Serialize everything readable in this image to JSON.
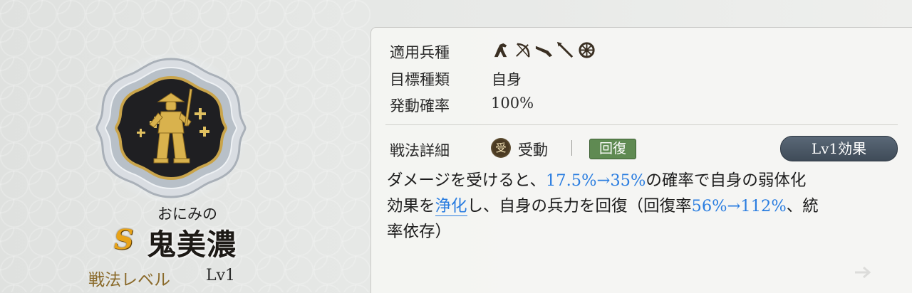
{
  "skill": {
    "furigana": "おにみの",
    "rarity": "S",
    "name": "鬼美濃",
    "level_label": "戦法レベル",
    "level_value": "Lv1",
    "emblem_icon": "armored-samurai-emblem-icon"
  },
  "info": {
    "troop_label": "適用兵種",
    "troop_icons": [
      "cavalry-icon",
      "bow-icon",
      "rifle-icon",
      "spear-icon",
      "siege-wheel-icon"
    ],
    "target_label": "目標種類",
    "target_value": "自身",
    "rate_label": "発動確率",
    "rate_value": "100%"
  },
  "details": {
    "label": "戦法詳細",
    "type_badge": "受",
    "type_text": "受動",
    "tag": "回復",
    "level_button": "Lv1効果",
    "desc": {
      "p1": "ダメージを受けると、",
      "n1": "17.5%→35%",
      "p2": "の確率で自身の弱体化",
      "p3": "効果を",
      "link": "浄化",
      "p4": "し、自身の兵力を回復（回復率",
      "n2": "56%→112%",
      "p5": "、統",
      "p6": "率依存）"
    }
  },
  "colors": {
    "highlight": "#2a7de0",
    "rarity": "#e8a317",
    "tag_bg": "#5f8a52",
    "button_bg": "#3f4b58"
  }
}
